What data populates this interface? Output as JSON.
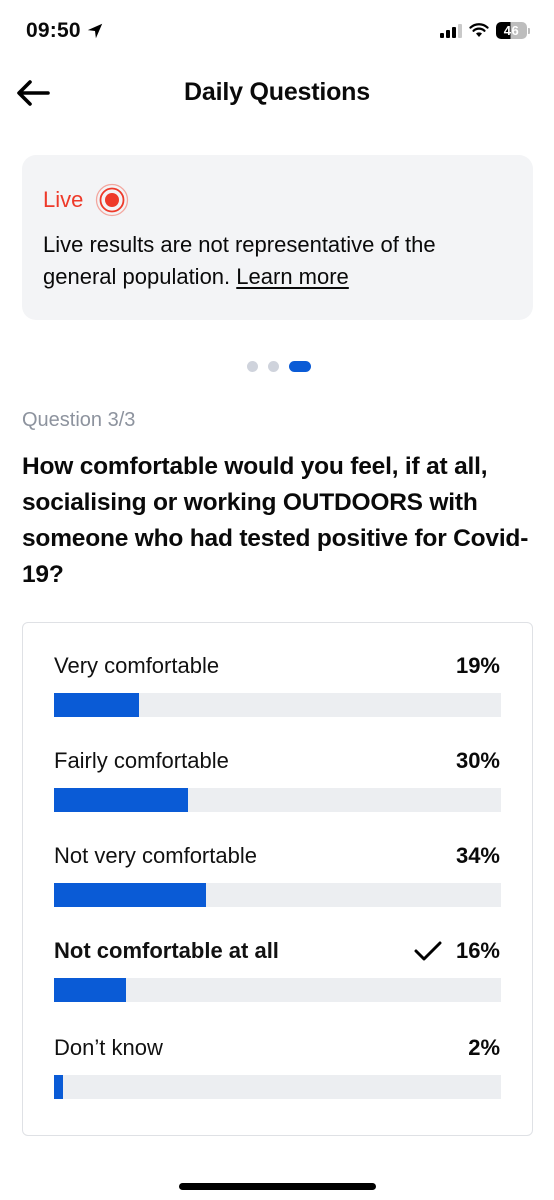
{
  "status_bar": {
    "time": "09:50",
    "location_icon": "location-arrow-icon",
    "signal_bars_on": 3,
    "signal_bars_total": 4,
    "wifi_icon": "wifi-icon",
    "battery_level": "46"
  },
  "nav": {
    "back_icon": "arrow-left-icon",
    "title": "Daily Questions"
  },
  "live_banner": {
    "label": "Live",
    "icon": "live-broadcast-icon",
    "text": "Live results are not representative of the general population.",
    "link": "Learn more",
    "accent": "#ee3a2a"
  },
  "pager": {
    "total": 3,
    "current": 3
  },
  "question": {
    "counter": "Question 3/3",
    "title": "How comfortable would you feel, if at all, socialising or working OUTDOORS with someone who had tested positive for Covid-19?"
  },
  "results": {
    "bar_color": "#0a5bd6",
    "options": [
      {
        "label": "Very comfortable",
        "percent_text": "19%",
        "percent": 19,
        "selected": false
      },
      {
        "label": "Fairly comfortable",
        "percent_text": "30%",
        "percent": 30,
        "selected": false
      },
      {
        "label": "Not very comfortable",
        "percent_text": "34%",
        "percent": 34,
        "selected": false
      },
      {
        "label": "Not comfortable at all",
        "percent_text": "16%",
        "percent": 16,
        "selected": true
      },
      {
        "label": "Don’t know",
        "percent_text": "2%",
        "percent": 2,
        "selected": false
      }
    ]
  }
}
